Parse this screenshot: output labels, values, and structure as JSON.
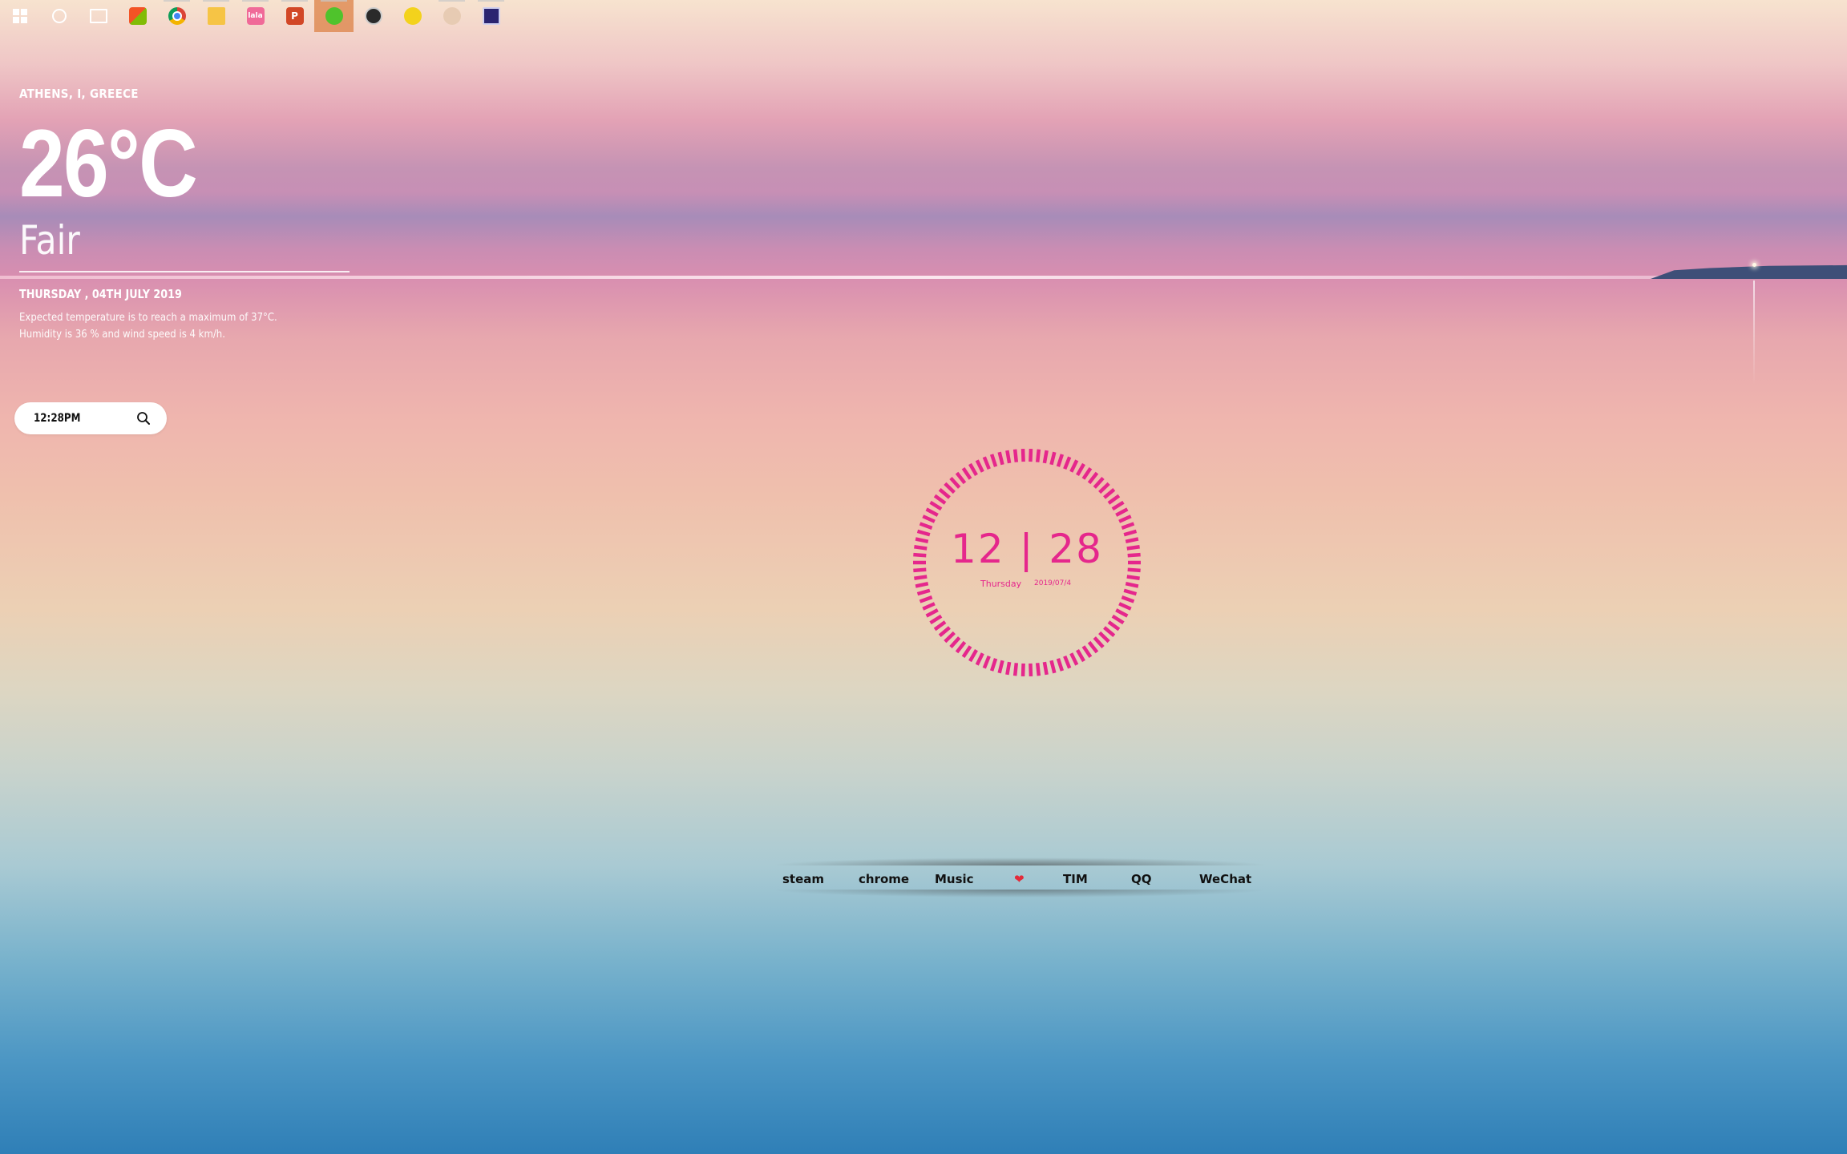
{
  "taskbar": {
    "icons": [
      {
        "name": "windows-start-icon"
      },
      {
        "name": "cortana-icon"
      },
      {
        "name": "task-view-icon"
      },
      {
        "name": "store-icon"
      },
      {
        "name": "chrome-icon"
      },
      {
        "name": "file-explorer-icon"
      },
      {
        "name": "lala-app-icon",
        "text": "lala"
      },
      {
        "name": "powerpoint-icon",
        "text": "P"
      },
      {
        "name": "wechat-icon",
        "active": true
      },
      {
        "name": "obs-icon"
      },
      {
        "name": "xing-app-icon"
      },
      {
        "name": "avatar-app-icon"
      },
      {
        "name": "visual-studio-icon"
      }
    ]
  },
  "weather": {
    "location": "ATHENS, I, GREECE",
    "temperature": "26°C",
    "condition": "Fair",
    "date": "THURSDAY , 04TH JULY 2019",
    "description_line1": "Expected temperature is to reach a maximum of 37°C.",
    "description_line2": "Humidity is 36 % and wind speed is 4 km/h."
  },
  "search": {
    "value": "12:28PM",
    "icon": "search-icon"
  },
  "clock": {
    "time": "12 | 28",
    "day": "Thursday",
    "date": "2019/07/4",
    "color": "#e5278c"
  },
  "dock": {
    "items": [
      "steam",
      "chrome",
      "Music",
      "❤",
      "TIM",
      "QQ",
      "WeChat"
    ]
  }
}
